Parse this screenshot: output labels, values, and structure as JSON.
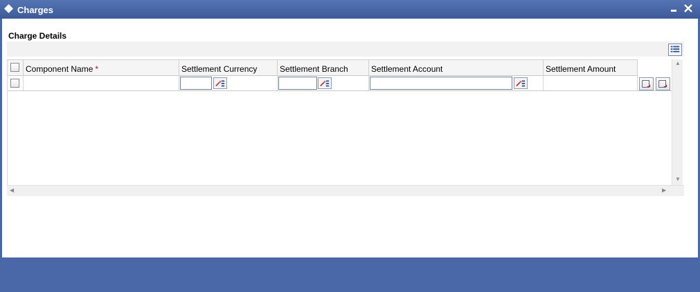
{
  "window": {
    "title": "Charges",
    "icons": {
      "app": "diamond-icon",
      "minimize": "minimize-icon",
      "close": "close-icon"
    }
  },
  "section": {
    "title": "Charge Details"
  },
  "toolbar": {
    "icon": "list-view-icon"
  },
  "table": {
    "columns": [
      {
        "label": "Component Name",
        "required": true
      },
      {
        "label": "Settlement Currency",
        "required": false
      },
      {
        "label": "Settlement Branch",
        "required": false
      },
      {
        "label": "Settlement Account",
        "required": false
      },
      {
        "label": "Settlement Amount",
        "required": false
      }
    ],
    "required_marker": "*",
    "rows": [
      {
        "component_name": "",
        "settlement_currency": "",
        "settlement_branch": "",
        "settlement_account": "",
        "settlement_amount": ""
      }
    ]
  },
  "colors": {
    "frame": "#4a68a8",
    "titlebar": "#3d5a98",
    "required": "#cc0000"
  }
}
